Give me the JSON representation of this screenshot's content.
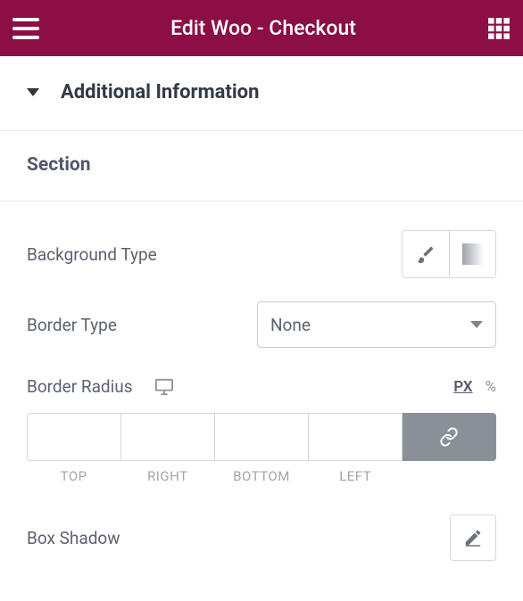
{
  "header": {
    "title": "Edit Woo - Checkout"
  },
  "panel": {
    "section_tab": "Additional Information",
    "subheading": "Section",
    "background_type": {
      "label": "Background Type"
    },
    "border_type": {
      "label": "Border Type",
      "selected": "None"
    },
    "border_radius": {
      "label": "Border Radius",
      "units": {
        "px": "PX",
        "percent": "%"
      },
      "sides": {
        "top": "TOP",
        "right": "RIGHT",
        "bottom": "BOTTOM",
        "left": "LEFT"
      }
    },
    "box_shadow": {
      "label": "Box Shadow"
    }
  }
}
